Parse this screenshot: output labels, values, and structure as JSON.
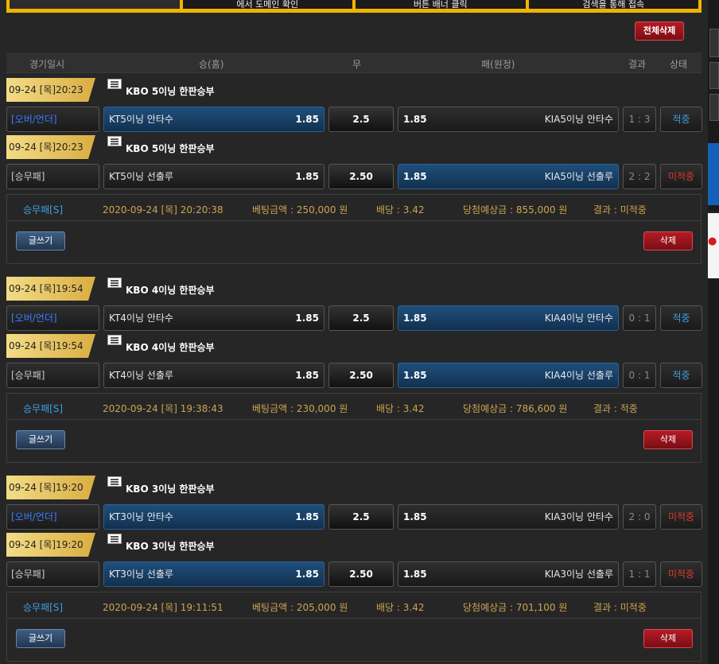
{
  "banner": [
    "에서 도메인 확인",
    "버튼 배너 클릭",
    "검색을 통해 접속"
  ],
  "toolbar": {
    "delete_all": "전체삭제"
  },
  "columns": {
    "date": "경기일시",
    "home": "승(홈)",
    "draw": "무",
    "away": "패(원정)",
    "result": "결과",
    "status": "상태"
  },
  "colors": {
    "accent_blue": "#3da0e6",
    "accent_red": "#e0392d",
    "gold": "#d9ad42"
  },
  "bets": [
    {
      "games": [
        {
          "date": "09-24 [목]20:23",
          "title": "KBO 5이닝 한판승부",
          "type": "[오버/언더]",
          "home_team": "KT5이닝 안타수",
          "home_odd": "1.85",
          "draw": "2.5",
          "away_odd": "1.85",
          "away_team": "KIA5이닝 안타수",
          "score": "1 : 3",
          "status": "적중",
          "pick": "home"
        },
        {
          "date": "09-24 [목]20:23",
          "title": "KBO 5이닝 한판승부",
          "type": "[승무패]",
          "home_team": "KT5이닝 선출루",
          "home_odd": "1.85",
          "draw": "2.50",
          "away_odd": "1.85",
          "away_team": "KIA5이닝 선출루",
          "score": "2 : 2",
          "status": "미적중",
          "pick": "away"
        }
      ],
      "summary": {
        "category": "승무패[S]",
        "datetime": "2020-09-24 [목] 20:20:38",
        "amount": "베팅금액 : 250,000 원",
        "odds": "배당 : 3.42",
        "expected": "당첨예상금 : 855,000 원",
        "result": "결과 : 미적중"
      },
      "write": "글쓰기",
      "delete": "삭제"
    },
    {
      "games": [
        {
          "date": "09-24 [목]19:54",
          "title": "KBO 4이닝 한판승부",
          "type": "[오버/언더]",
          "home_team": "KT4이닝 안타수",
          "home_odd": "1.85",
          "draw": "2.5",
          "away_odd": "1.85",
          "away_team": "KIA4이닝 안타수",
          "score": "0 : 1",
          "status": "적중",
          "pick": "away"
        },
        {
          "date": "09-24 [목]19:54",
          "title": "KBO 4이닝 한판승부",
          "type": "[승무패]",
          "home_team": "KT4이닝 선출루",
          "home_odd": "1.85",
          "draw": "2.50",
          "away_odd": "1.85",
          "away_team": "KIA4이닝 선출루",
          "score": "0 : 1",
          "status": "적중",
          "pick": "away"
        }
      ],
      "summary": {
        "category": "승무패[S]",
        "datetime": "2020-09-24 [목] 19:38:43",
        "amount": "베팅금액 : 230,000 원",
        "odds": "배당 : 3.42",
        "expected": "당첨예상금 : 786,600 원",
        "result": "결과 : 적중"
      },
      "write": "글쓰기",
      "delete": "삭제"
    },
    {
      "games": [
        {
          "date": "09-24 [목]19:20",
          "title": "KBO 3이닝 한판승부",
          "type": "[오버/언더]",
          "home_team": "KT3이닝 안타수",
          "home_odd": "1.85",
          "draw": "2.5",
          "away_odd": "1.85",
          "away_team": "KIA3이닝 안타수",
          "score": "2 : 0",
          "status": "미적중",
          "pick": "home"
        },
        {
          "date": "09-24 [목]19:20",
          "title": "KBO 3이닝 한판승부",
          "type": "[승무패]",
          "home_team": "KT3이닝 선출루",
          "home_odd": "1.85",
          "draw": "2.50",
          "away_odd": "1.85",
          "away_team": "KIA3이닝 선출루",
          "score": "1 : 1",
          "status": "미적중",
          "pick": "home"
        }
      ],
      "summary": {
        "category": "승무패[S]",
        "datetime": "2020-09-24 [목] 19:11:51",
        "amount": "베팅금액 : 205,000 원",
        "odds": "배당 : 3.42",
        "expected": "당첨예상금 : 701,100 원",
        "result": "결과 : 미적중"
      },
      "write": "글쓰기",
      "delete": "삭제"
    }
  ]
}
